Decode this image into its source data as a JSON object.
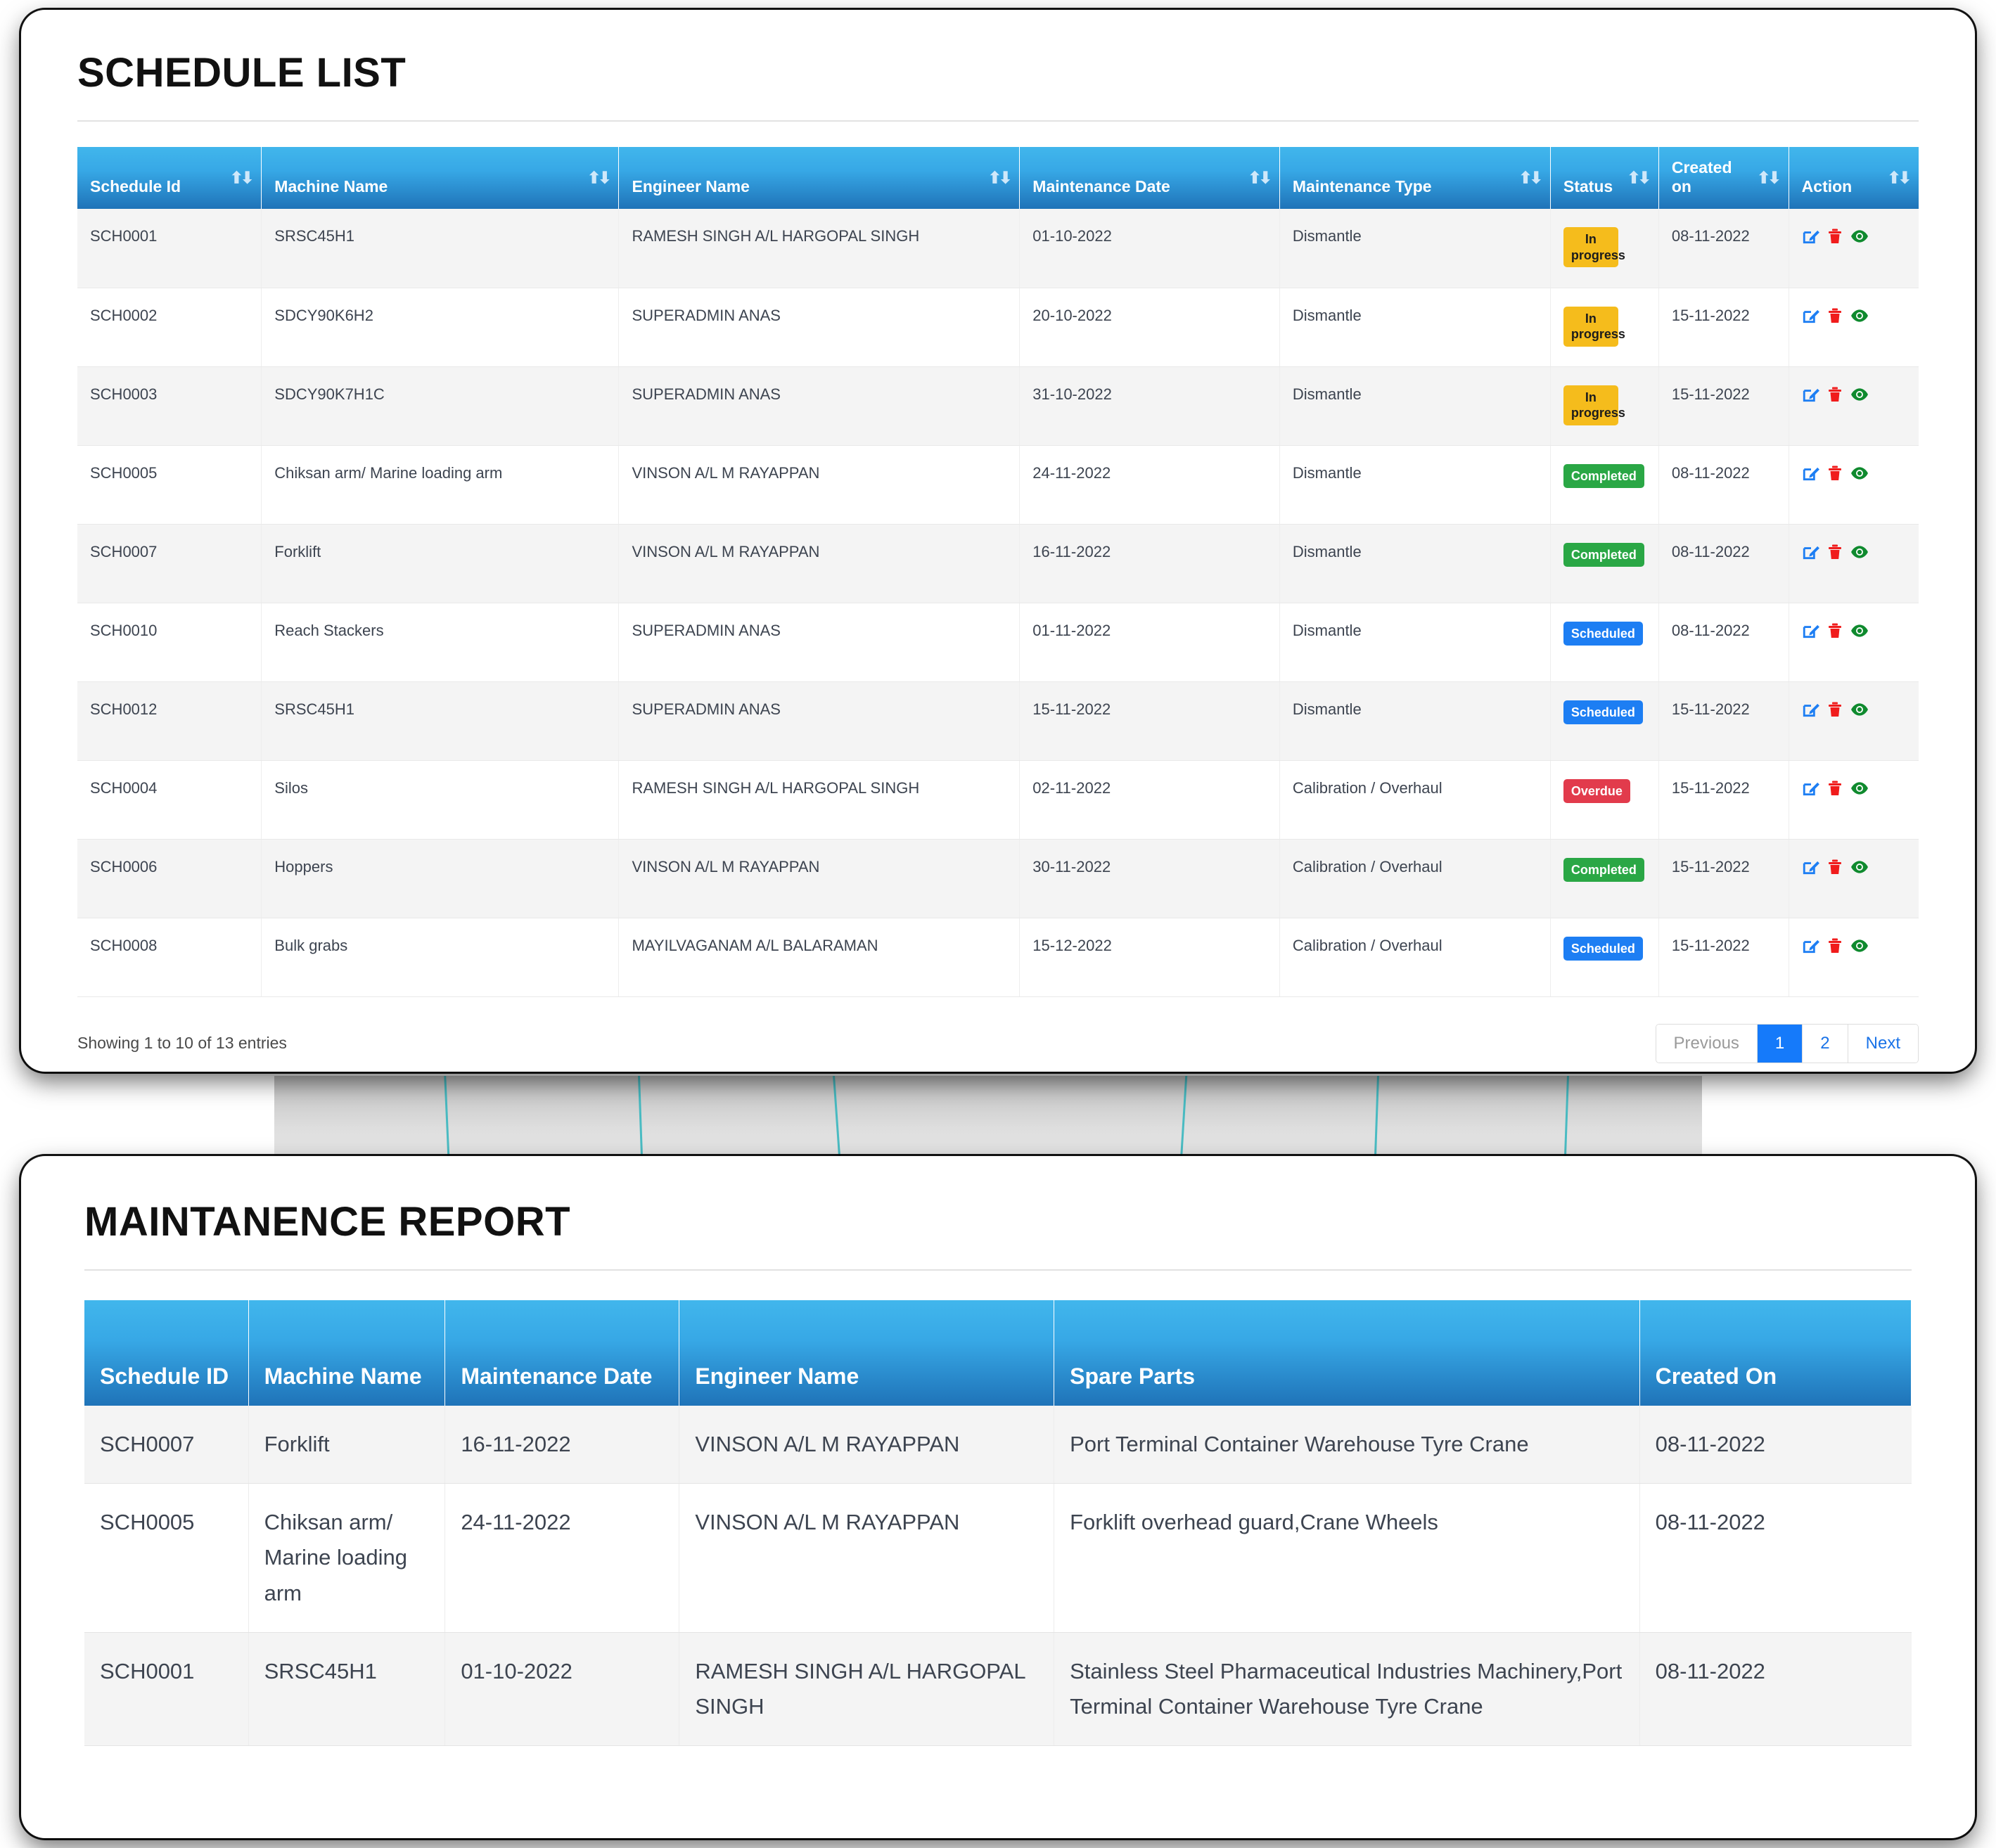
{
  "schedule_card": {
    "title": "SCHEDULE LIST",
    "columns": [
      {
        "label": "Schedule Id",
        "sortable": true,
        "sort_icon": "sort-asc-icon"
      },
      {
        "label": "Machine Name",
        "sortable": true,
        "sort_icon": "sort-icon"
      },
      {
        "label": "Engineer Name",
        "sortable": true,
        "sort_icon": "sort-icon"
      },
      {
        "label": "Maintenance Date",
        "sortable": true,
        "sort_icon": "sort-icon"
      },
      {
        "label": "Maintenance Type",
        "sortable": true,
        "sort_icon": "sort-icon"
      },
      {
        "label": "Status",
        "sortable": true,
        "sort_icon": "sort-icon"
      },
      {
        "label": "Created on",
        "sortable": true,
        "sort_icon": "sort-icon"
      },
      {
        "label": "Action",
        "sortable": true,
        "sort_icon": "sort-icon"
      }
    ],
    "rows": [
      {
        "schedule_id": "SCH0001",
        "machine_name": "SRSC45H1",
        "engineer_name": "RAMESH SINGH A/L HARGOPAL SINGH",
        "maintenance_date": "01-10-2022",
        "maintenance_type": "Dismantle",
        "status": "In progress",
        "status_kind": "inprogress",
        "created_on": "08-11-2022"
      },
      {
        "schedule_id": "SCH0002",
        "machine_name": "SDCY90K6H2",
        "engineer_name": "SUPERADMIN ANAS",
        "maintenance_date": "20-10-2022",
        "maintenance_type": "Dismantle",
        "status": "In progress",
        "status_kind": "inprogress",
        "created_on": "15-11-2022"
      },
      {
        "schedule_id": "SCH0003",
        "machine_name": "SDCY90K7H1C",
        "engineer_name": "SUPERADMIN ANAS",
        "maintenance_date": "31-10-2022",
        "maintenance_type": "Dismantle",
        "status": "In progress",
        "status_kind": "inprogress",
        "created_on": "15-11-2022"
      },
      {
        "schedule_id": "SCH0005",
        "machine_name": "Chiksan arm/ Marine loading arm",
        "engineer_name": "VINSON A/L M RAYAPPAN",
        "maintenance_date": "24-11-2022",
        "maintenance_type": "Dismantle",
        "status": "Completed",
        "status_kind": "completed",
        "created_on": "08-11-2022"
      },
      {
        "schedule_id": "SCH0007",
        "machine_name": "Forklift",
        "engineer_name": "VINSON A/L M RAYAPPAN",
        "maintenance_date": "16-11-2022",
        "maintenance_type": "Dismantle",
        "status": "Completed",
        "status_kind": "completed",
        "created_on": "08-11-2022"
      },
      {
        "schedule_id": "SCH0010",
        "machine_name": "Reach Stackers",
        "engineer_name": "SUPERADMIN ANAS",
        "maintenance_date": "01-11-2022",
        "maintenance_type": "Dismantle",
        "status": "Scheduled",
        "status_kind": "scheduled",
        "created_on": "08-11-2022"
      },
      {
        "schedule_id": "SCH0012",
        "machine_name": "SRSC45H1",
        "engineer_name": "SUPERADMIN ANAS",
        "maintenance_date": "15-11-2022",
        "maintenance_type": "Dismantle",
        "status": "Scheduled",
        "status_kind": "scheduled",
        "created_on": "15-11-2022"
      },
      {
        "schedule_id": "SCH0004",
        "machine_name": "Silos",
        "engineer_name": "RAMESH SINGH A/L HARGOPAL SINGH",
        "maintenance_date": "02-11-2022",
        "maintenance_type": "Calibration / Overhaul",
        "status": "Overdue",
        "status_kind": "overdue",
        "created_on": "15-11-2022"
      },
      {
        "schedule_id": "SCH0006",
        "machine_name": "Hoppers",
        "engineer_name": "VINSON A/L M RAYAPPAN",
        "maintenance_date": "30-11-2022",
        "maintenance_type": "Calibration / Overhaul",
        "status": "Completed",
        "status_kind": "completed",
        "created_on": "15-11-2022"
      },
      {
        "schedule_id": "SCH0008",
        "machine_name": "Bulk grabs",
        "engineer_name": "MAYILVAGANAM A/L BALARAMAN",
        "maintenance_date": "15-12-2022",
        "maintenance_type": "Calibration / Overhaul",
        "status": "Scheduled",
        "status_kind": "scheduled",
        "created_on": "15-11-2022"
      }
    ],
    "row_actions": [
      {
        "name": "edit-icon",
        "color": "#1d7ef3"
      },
      {
        "name": "delete-icon",
        "color": "#f01c1c"
      },
      {
        "name": "view-icon",
        "color": "#0f8a2e"
      }
    ],
    "footer": {
      "showing": "Showing 1 to 10 of 13 entries",
      "pagination": [
        {
          "label": "Previous",
          "state": "disabled"
        },
        {
          "label": "1",
          "state": "active"
        },
        {
          "label": "2",
          "state": "normal"
        },
        {
          "label": "Next",
          "state": "normal"
        }
      ]
    }
  },
  "report_card": {
    "title": "MAINTANENCE REPORT",
    "columns": [
      "Schedule ID",
      "Machine Name",
      "Maintenance Date",
      "Engineer Name",
      "Spare Parts",
      "Created On"
    ],
    "rows": [
      {
        "schedule_id": "SCH0007",
        "machine_name": "Forklift",
        "maintenance_date": "16-11-2022",
        "engineer_name": "VINSON A/L M RAYAPPAN",
        "spare_parts": "Port Terminal Container Warehouse Tyre Crane",
        "created_on": "08-11-2022"
      },
      {
        "schedule_id": "SCH0005",
        "machine_name": "Chiksan arm/ Marine loading arm",
        "maintenance_date": "24-11-2022",
        "engineer_name": "VINSON A/L M RAYAPPAN",
        "spare_parts": "Forklift overhead guard,Crane Wheels",
        "created_on": "08-11-2022"
      },
      {
        "schedule_id": "SCH0001",
        "machine_name": "SRSC45H1",
        "maintenance_date": "01-10-2022",
        "engineer_name": "RAMESH SINGH A/L HARGOPAL SINGH",
        "spare_parts": "Stainless Steel Pharmaceutical Industries Machinery,Port Terminal Container Warehouse Tyre Crane",
        "created_on": "08-11-2022"
      }
    ]
  },
  "colors": {
    "header_gradient_top": "#41b6ec",
    "header_gradient_bottom": "#1f73b8",
    "badge_inprogress": "#f5bc1c",
    "badge_completed": "#2aa745",
    "badge_scheduled": "#1d7ef3",
    "badge_overdue": "#e23b4c",
    "pager_active": "#157afa",
    "link": "#1a73e8"
  }
}
